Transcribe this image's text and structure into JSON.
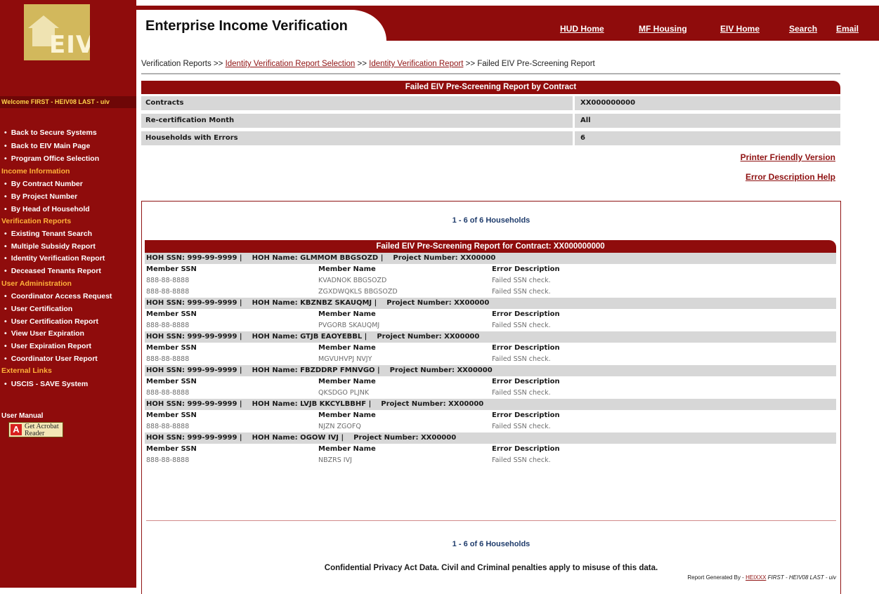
{
  "logo_text": "EIV",
  "sidebar": {
    "welcome": "Welcome FIRST - HEIV08 LAST - uiv",
    "sections": [
      {
        "heading": "",
        "items": [
          "Back to Secure Systems",
          "Back to EIV Main Page",
          "Program Office Selection"
        ]
      },
      {
        "heading": "Income Information",
        "items": [
          "By Contract Number",
          "By Project Number",
          "By Head of Household"
        ]
      },
      {
        "heading": "Verification Reports",
        "items": [
          "Existing Tenant Search",
          "Multiple Subsidy Report",
          "Identity Verification Report",
          "Deceased Tenants Report"
        ]
      },
      {
        "heading": "User Administration",
        "items": [
          "Coordinator Access Request",
          "User Certification",
          "User Certification Report",
          "View User Expiration",
          "User Expiration Report",
          "Coordinator User Report"
        ]
      },
      {
        "heading": "External Links",
        "items": [
          "USCIS - SAVE System"
        ]
      }
    ],
    "user_manual": "User Manual",
    "acrobat": {
      "line1": "Get Acrobat",
      "line2": "Reader",
      "icon": "adobe-icon"
    }
  },
  "header": {
    "title": "Enterprise Income Verification",
    "links": [
      "HUD Home",
      "MF Housing",
      "EIV Home",
      "Search",
      "Email"
    ]
  },
  "breadcrumb": {
    "root": "Verification Reports",
    "sep": ">>",
    "link1": "Identity Verification Report Selection",
    "link2": "Identity Verification Report",
    "current": "Failed EIV Pre-Screening Report"
  },
  "summary": {
    "title": "Failed EIV Pre-Screening Report by Contract",
    "rows": [
      {
        "label": "Contracts",
        "value": "XX000000000"
      },
      {
        "label": "Re-certification Month",
        "value": "All"
      },
      {
        "label": "Households with Errors",
        "value": "6"
      }
    ],
    "printer_link": "Printer Friendly Version",
    "help_link": "Error Description Help"
  },
  "results": {
    "count_text": "1 - 6 of 6 Households",
    "report_title": "Failed EIV Pre-Screening Report for Contract: XX000000000",
    "columns": [
      "Member SSN",
      "Member Name",
      "Error Description"
    ],
    "households": [
      {
        "hoh_ssn": "HOH SSN: 999-99-9999 |",
        "hoh_name": "HOH Name: GLMMOM BBGSOZD |",
        "project": "Project Number: XX00000",
        "members": [
          {
            "ssn": "888-88-8888",
            "name": "KVADNOK BBGSOZD",
            "error": "Failed SSN check."
          },
          {
            "ssn": "888-88-8888",
            "name": "ZGXDWQKLS BBGSOZD",
            "error": "Failed SSN check."
          }
        ]
      },
      {
        "hoh_ssn": "HOH SSN: 999-99-9999 |",
        "hoh_name": "HOH Name: KBZNBZ SKAUQMJ |",
        "project": "Project Number: XX00000",
        "members": [
          {
            "ssn": "888-88-8888",
            "name": "PVGORB SKAUQMJ",
            "error": "Failed SSN check."
          }
        ]
      },
      {
        "hoh_ssn": "HOH SSN: 999-99-9999 |",
        "hoh_name": "HOH Name: GTJB EAOYEBBL |",
        "project": "Project Number: XX00000",
        "members": [
          {
            "ssn": "888-88-8888",
            "name": "MGVUHVPJ NVJY",
            "error": "Failed SSN check."
          }
        ]
      },
      {
        "hoh_ssn": "HOH SSN: 999-99-9999 |",
        "hoh_name": "HOH Name: FBZDDRP FMNVGO |",
        "project": "Project Number: XX00000",
        "members": [
          {
            "ssn": "888-88-8888",
            "name": "QKSDGO PLJNK",
            "error": "Failed SSN check."
          }
        ]
      },
      {
        "hoh_ssn": "HOH SSN: 999-99-9999 |",
        "hoh_name": "HOH Name: LVJB KKCYLBBHF |",
        "project": "Project Number: XX00000",
        "members": [
          {
            "ssn": "888-88-8888",
            "name": "NJZN ZGOFQ",
            "error": "Failed SSN check."
          }
        ]
      },
      {
        "hoh_ssn": "HOH SSN: 999-99-9999 |",
        "hoh_name": "HOH Name: OGOW IVJ |",
        "project": "Project Number: XX00000",
        "members": [
          {
            "ssn": "888-88-8888",
            "name": "NBZRS IVJ",
            "error": "Failed SSN check."
          }
        ]
      }
    ],
    "privacy_notice": "Confidential Privacy Act Data. Civil and Criminal penalties apply to misuse of this data.",
    "generated_prefix": "Report Generated By -",
    "generated_user_id": "HEIXXX",
    "generated_user_name": "FIRST - HEIV08 LAST - uiv"
  },
  "colors": {
    "brand_red": "#8f0c0c",
    "accent_gold": "#ffb23a",
    "row_gray": "#d7d7d7",
    "link_red": "#8f1212"
  }
}
